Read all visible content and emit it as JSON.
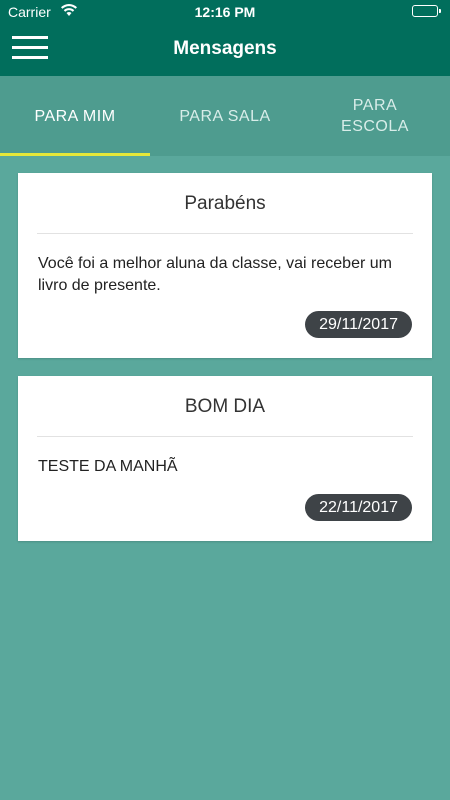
{
  "status_bar": {
    "carrier": "Carrier",
    "time": "12:16 PM",
    "wifi_icon": "wifi-icon",
    "battery_icon": "battery-icon"
  },
  "header": {
    "title": "Mensagens",
    "menu_icon": "hamburger-menu-icon"
  },
  "tabs": [
    {
      "label": "PARA MIM",
      "active": true
    },
    {
      "label": "PARA SALA",
      "active": false
    },
    {
      "label": "PARA ESCOLA",
      "active": false
    }
  ],
  "messages": [
    {
      "title": "Parabéns",
      "body": "Você foi a melhor aluna da classe, vai receber um livro de presente.",
      "date": "29/11/2017"
    },
    {
      "title": "BOM DIA",
      "body": "TESTE DA MANHÃ",
      "date": "22/11/2017"
    }
  ],
  "colors": {
    "primary": "#016e5c",
    "tab_bar": "#4e9c8f",
    "background": "#5aa89c",
    "tab_indicator": "#e5e83a",
    "date_badge": "#3e4347"
  }
}
